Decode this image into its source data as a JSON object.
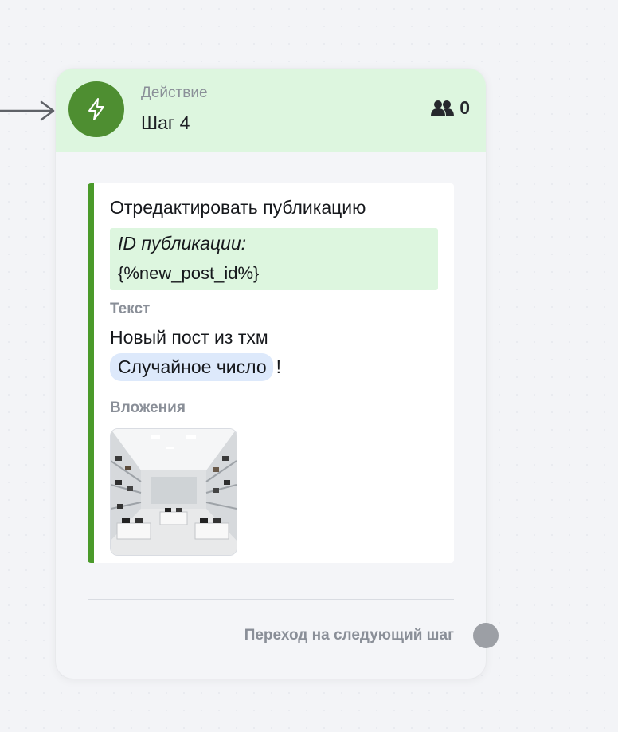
{
  "step": {
    "type_label": "Действие",
    "title": "Шаг 4",
    "subscribers_count": "0",
    "icon": "lightning-icon",
    "color": "#4e8e31"
  },
  "action": {
    "title": "Отредактировать публикацию",
    "param_label": "ID публикации:",
    "param_value": "{%new_post_id%}",
    "text_label": "Текст",
    "text_line": "Новый пост из тхм",
    "variable_chip": "Случайное число",
    "text_suffix": "!",
    "attachments_label": "Вложения",
    "attachment_icon": "store-photo-thumbnail"
  },
  "footer": {
    "next_step_label": "Переход на следующий шаг"
  },
  "colors": {
    "header_bg": "#ddf6df",
    "accent_bar": "#4a9a2a",
    "chip_bg": "#dde9fb"
  }
}
